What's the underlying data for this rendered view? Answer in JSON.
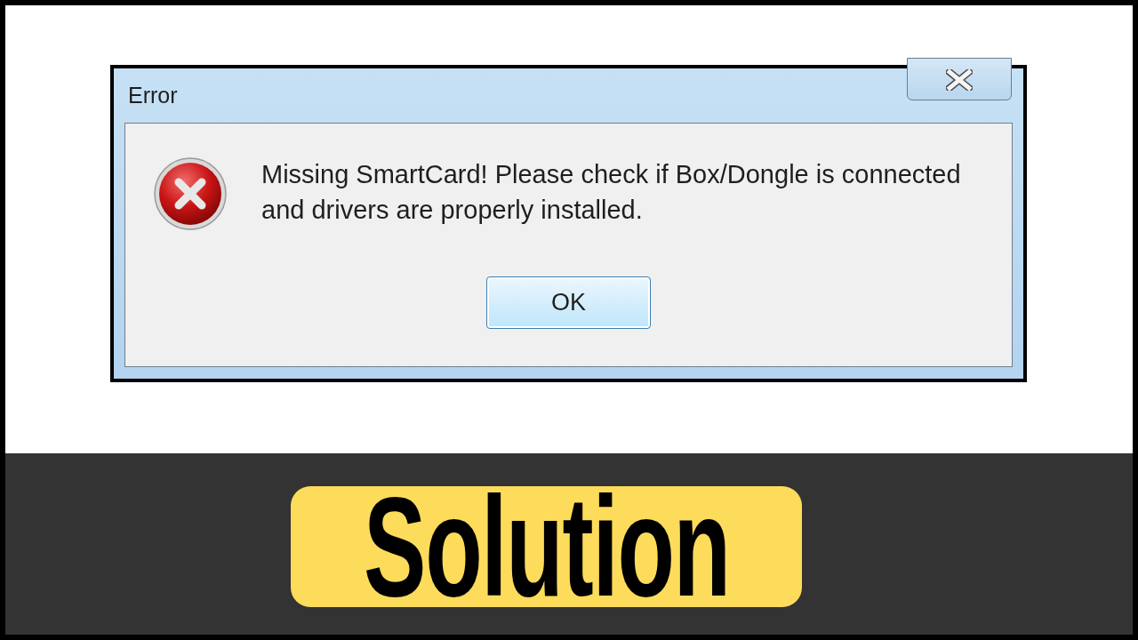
{
  "dialog": {
    "title": "Error",
    "message": "Missing SmartCard! Please check if Box/Dongle is connected and drivers are properly installed.",
    "buttons": [
      "OK"
    ]
  },
  "banner": {
    "label": "Solution"
  }
}
